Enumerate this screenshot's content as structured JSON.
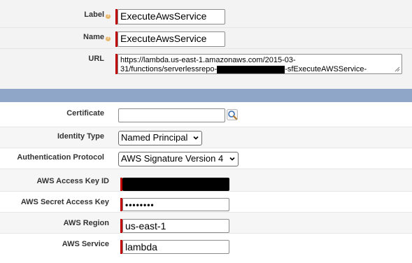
{
  "top_section": {
    "label_field": {
      "label": "Label",
      "value": "ExecuteAwsService"
    },
    "name_field": {
      "label": "Name",
      "value": "ExecuteAwsService"
    },
    "url_field": {
      "label": "URL",
      "line1": "https://lambda.us-east-1.amazonaws.com/2015-03-",
      "line2_prefix": "31/functions/serverlessrepo-",
      "line2_suffix": "-sfExecuteAWSService-"
    }
  },
  "auth_section": {
    "certificate": {
      "label": "Certificate",
      "value": ""
    },
    "identity_type": {
      "label": "Identity Type",
      "selected": "Named Principal"
    },
    "auth_protocol": {
      "label": "Authentication Protocol",
      "selected": "AWS Signature Version 4"
    },
    "access_key": {
      "label": "AWS Access Key ID"
    },
    "secret_key": {
      "label": "AWS Secret Access Key",
      "value": "••••••••"
    },
    "region": {
      "label": "AWS Region",
      "value": "us-east-1"
    },
    "service": {
      "label": "AWS Service",
      "value": "lambda"
    }
  },
  "colors": {
    "required": "#c00000",
    "section_header": "#8fa6c9",
    "help": "#e8b76b"
  },
  "icons": {
    "help": "help-icon",
    "lookup": "lookup-icon",
    "dropdown": "chevron-down-icon",
    "resize": "resize-grip-icon"
  }
}
